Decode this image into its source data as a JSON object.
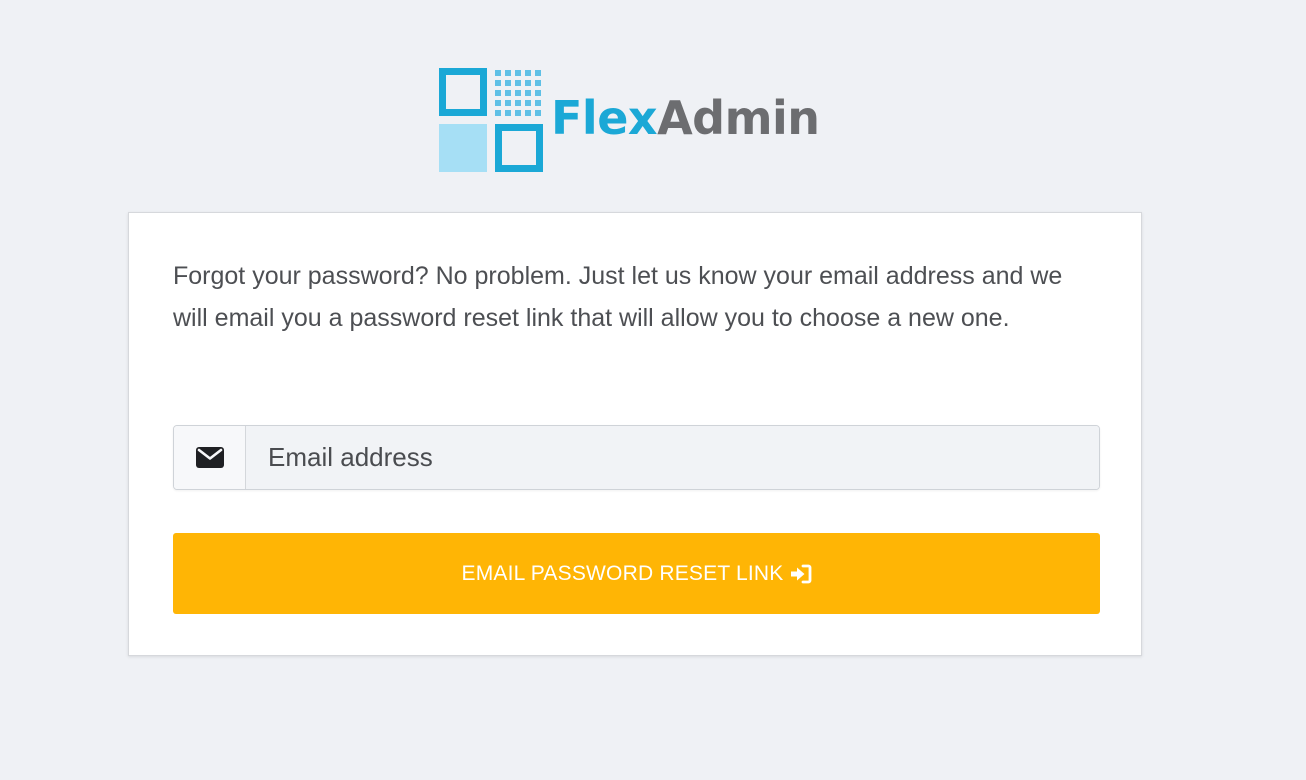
{
  "logo": {
    "brand_part_1": "Flex",
    "brand_part_2": "Admin",
    "mark_icon": "grid-squares-logo-icon"
  },
  "card": {
    "intro_text": "Forgot your password? No problem. Just let us know your email address and we will email you a password reset link that will allow you to choose a new one.",
    "email_field": {
      "icon": "envelope-icon",
      "placeholder": "Email address",
      "value": ""
    },
    "submit_button": {
      "label": "EMAIL PASSWORD RESET LINK",
      "icon": "sign-in-icon"
    }
  },
  "colors": {
    "page_background": "#eff1f5",
    "brand_blue": "#1ba8d6",
    "brand_light_blue": "#a6dff5",
    "brand_gray": "#6c6d70",
    "button_amber": "#ffb505"
  }
}
